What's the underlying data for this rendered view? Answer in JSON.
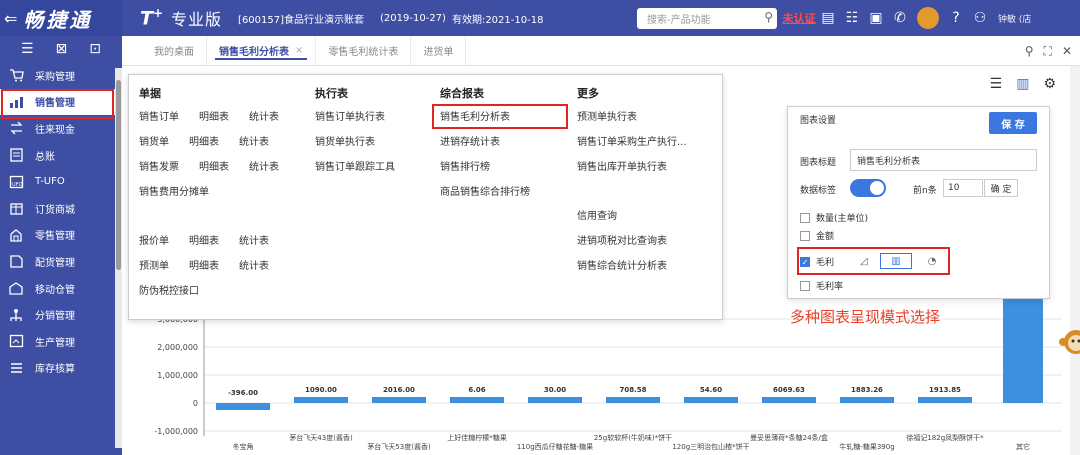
{
  "brand": {
    "back": "⇐",
    "name": "畅捷通"
  },
  "header": {
    "logo": "T",
    "logo_sup": "+",
    "edition": "专业版",
    "account": "[600157]食品行业演示账套",
    "period": "(2019-10-27)",
    "validity": "有效期:2021-10-18",
    "search_placeholder": "搜索-产品功能",
    "verify": "未认证",
    "user": "钟敏 (店"
  },
  "sidebar": {
    "items": [
      {
        "label": "采购管理",
        "icon": "cart-icon"
      },
      {
        "label": "销售管理",
        "icon": "sales-icon"
      },
      {
        "label": "往来现金",
        "icon": "exchange-icon"
      },
      {
        "label": "总账",
        "icon": "ledger-icon"
      },
      {
        "label": "T-UFO",
        "icon": "ufo-icon"
      },
      {
        "label": "订货商城",
        "icon": "mall-icon"
      },
      {
        "label": "零售管理",
        "icon": "retail-icon"
      },
      {
        "label": "配货管理",
        "icon": "distribution-icon"
      },
      {
        "label": "移动仓管",
        "icon": "warehouse-icon"
      },
      {
        "label": "分销管理",
        "icon": "network-icon"
      },
      {
        "label": "生产管理",
        "icon": "production-icon"
      },
      {
        "label": "库存核算",
        "icon": "inventory-icon"
      }
    ],
    "active_index": 1
  },
  "tabs": [
    {
      "label": "我的桌面",
      "active": false,
      "closable": false
    },
    {
      "label": "销售毛利分析表",
      "active": true,
      "closable": true
    },
    {
      "label": "零售毛利统计表",
      "active": false,
      "closable": false
    },
    {
      "label": "进货单",
      "active": false,
      "closable": false
    }
  ],
  "menu": {
    "col1": {
      "head": "单据",
      "rows": [
        [
          "销售订单",
          "明细表",
          "统计表"
        ],
        [
          "销货单",
          "明细表",
          "统计表"
        ],
        [
          "销售发票",
          "明细表",
          "统计表"
        ],
        [
          "销售费用分摊单"
        ],
        [],
        [
          "报价单",
          "明细表",
          "统计表"
        ],
        [
          "预测单",
          "明细表",
          "统计表"
        ],
        [
          "防伪税控接口"
        ]
      ]
    },
    "col2": {
      "head": "执行表",
      "rows": [
        "销售订单执行表",
        "销货单执行表",
        "销售订单跟踪工具"
      ]
    },
    "col3": {
      "head": "综合报表",
      "rows": [
        "销售毛利分析表",
        "进销存统计表",
        "销售排行榜",
        "商品销售综合排行榜"
      ]
    },
    "col4": {
      "head": "更多",
      "rows": [
        "预测单执行表",
        "销售订单采购生产执行...",
        "销售出库开单执行表",
        "",
        "信用查询",
        "进销项税对比查询表",
        "销售综合统计分析表"
      ]
    }
  },
  "settings": {
    "title": "图表设置",
    "save": "保 存",
    "chart_title_label": "图表标题",
    "chart_title_value": "销售毛利分析表",
    "data_label_label": "数据标签",
    "top_n_label": "前n条",
    "top_n_value": "10",
    "confirm": "确 定",
    "options": [
      {
        "label": "数量(主单位)",
        "checked": false
      },
      {
        "label": "金额",
        "checked": false
      },
      {
        "label": "毛利",
        "checked": true
      },
      {
        "label": "毛利率",
        "checked": false
      }
    ]
  },
  "annotation": "多种图表呈现模式选择",
  "chart_data": {
    "type": "bar",
    "categories": [
      "冬宝角",
      "茅台飞天43度(酱香)",
      "茅台飞天53度(酱香)",
      "上好佳糖柠檬*糖果",
      "110g西瓜仔糖花糖-糖果",
      "25g软软杯(牛奶味)*饼干",
      "120g三明治包山楂*饼干",
      "曼妥思薄荷*条糖24条/盒",
      "牛轧糖-糖果390g",
      "徐福记182g凤梨酥饼干*",
      "其它"
    ],
    "values": [
      -396.0,
      1090.0,
      2016.0,
      6.06,
      30.0,
      708.58,
      54.6,
      6069.63,
      1883.26,
      1913.85,
      5600000
    ],
    "data_labels": [
      "-396.00",
      "1090.00",
      "2016.00",
      "6.06",
      "30.00",
      "708.58",
      "54.60",
      "6069.63",
      "1883.26",
      "1913.85",
      ""
    ],
    "y_ticks": [
      "3,000,000",
      "2,000,000",
      "1,000,000",
      "0",
      "-1,000,000"
    ],
    "ylim": [
      -1000000,
      3500000
    ],
    "grid": true
  }
}
